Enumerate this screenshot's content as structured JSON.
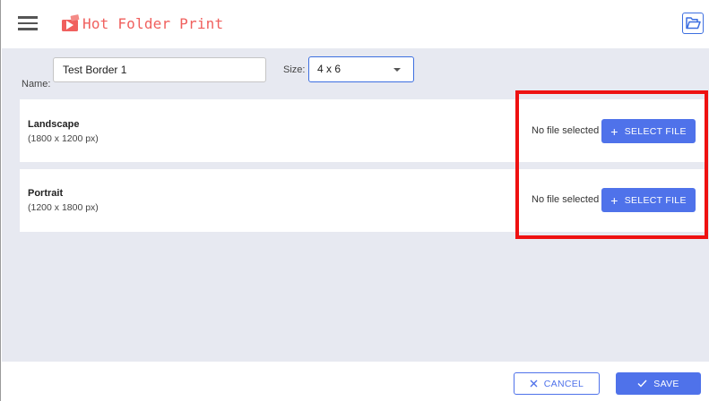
{
  "header": {
    "title": "Hot Folder Print",
    "menu_icon": "hamburger-menu-icon",
    "logo_icon": "hot-folder-logo-icon",
    "open_folder_icon": "open-folder-icon"
  },
  "form": {
    "name_label": "Name:",
    "name_value": "Test Border 1",
    "size_label": "Size:",
    "size_value": "4 x 6"
  },
  "cards": [
    {
      "title": "Landscape",
      "subtitle": "(1800 x 1200 px)",
      "file_status": "No file selected",
      "button_label": "SELECT FILE"
    },
    {
      "title": "Portrait",
      "subtitle": "(1200 x 1800 px)",
      "file_status": "No file selected",
      "button_label": "SELECT FILE"
    }
  ],
  "footer": {
    "cancel_label": "CANCEL",
    "save_label": "SAVE"
  },
  "colors": {
    "accent": "#4f72ea",
    "brand": "#f0605e",
    "highlight": "#ee1111",
    "content_bg": "#e7e9f1"
  }
}
